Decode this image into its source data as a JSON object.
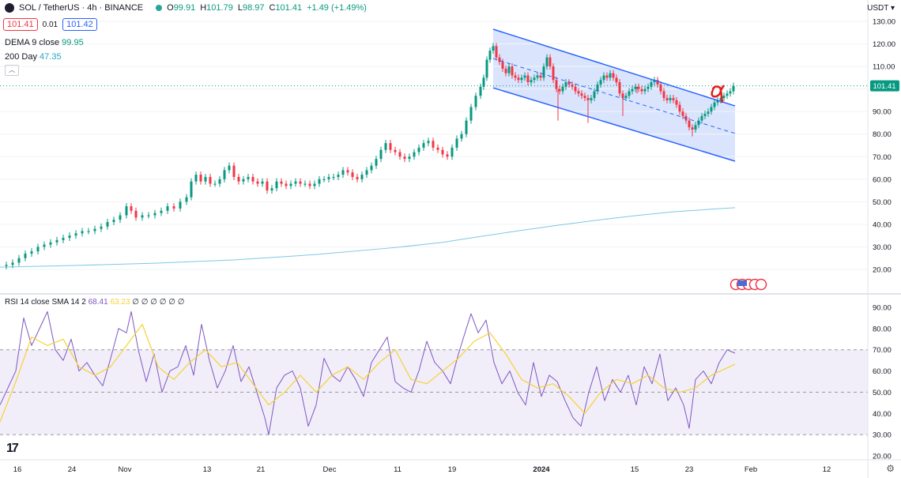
{
  "header": {
    "symbol": "SOL / TetherUS · 4h · BINANCE",
    "ohlc": [
      {
        "label": "O",
        "value": "99.91"
      },
      {
        "label": "H",
        "value": "101.79"
      },
      {
        "label": "L",
        "value": "98.97"
      },
      {
        "label": "C",
        "value": "101.41"
      }
    ],
    "change": "+1.49 (+1.49%)",
    "sell_price": "101.41",
    "spread": "0.01",
    "buy_price": "101.42",
    "currency": "USDT ▾"
  },
  "indicators": [
    {
      "name": "DEMA 9 close",
      "value": "99.95"
    },
    {
      "name": "200 Day",
      "value": "47.35"
    }
  ],
  "rsi_legend": {
    "name": "RSI 14 close SMA 14 2",
    "rsi": "68.41",
    "sma": "63.23",
    "rest": "∅ ∅ ∅ ∅ ∅ ∅"
  },
  "logo_text": "17",
  "chart_data": [
    {
      "type": "candlestick",
      "title": "SOL / TetherUS · 4h · BINANCE",
      "ylim": [
        15,
        132
      ],
      "yticks": [
        20,
        30,
        40,
        50,
        60,
        70,
        80,
        90,
        100,
        110,
        120,
        130
      ],
      "ytick_labels": [
        "20.00",
        "30.00",
        "40.00",
        "50.00",
        "60.00",
        "70.00",
        "80.00",
        "90.00",
        "",
        "110.00",
        "120.00",
        "130.00"
      ],
      "last_price": 101.41,
      "last_price_label": "101.41",
      "xticks": [
        "16",
        "24",
        "Nov",
        "13",
        "21",
        "Dec",
        "11",
        "19",
        "2024",
        "15",
        "23",
        "Feb",
        "12"
      ],
      "price_path": [
        [
          0,
          21.5
        ],
        [
          8,
          22
        ],
        [
          16,
          23
        ],
        [
          24,
          25
        ],
        [
          32,
          27
        ],
        [
          40,
          28
        ],
        [
          48,
          30
        ],
        [
          56,
          31
        ],
        [
          64,
          32
        ],
        [
          72,
          33
        ],
        [
          80,
          34
        ],
        [
          88,
          35
        ],
        [
          96,
          36
        ],
        [
          104,
          37
        ],
        [
          112,
          37
        ],
        [
          120,
          38
        ],
        [
          128,
          39
        ],
        [
          136,
          41
        ],
        [
          144,
          42
        ],
        [
          152,
          44
        ],
        [
          160,
          48
        ],
        [
          166,
          46
        ],
        [
          172,
          43
        ],
        [
          180,
          44
        ],
        [
          188,
          44
        ],
        [
          196,
          45
        ],
        [
          204,
          46
        ],
        [
          212,
          48
        ],
        [
          220,
          47
        ],
        [
          228,
          50
        ],
        [
          236,
          52
        ],
        [
          242,
          59
        ],
        [
          248,
          62
        ],
        [
          254,
          59
        ],
        [
          260,
          61
        ],
        [
          266,
          58
        ],
        [
          272,
          58
        ],
        [
          278,
          60
        ],
        [
          284,
          64
        ],
        [
          290,
          66
        ],
        [
          296,
          61
        ],
        [
          302,
          59
        ],
        [
          308,
          60
        ],
        [
          314,
          61
        ],
        [
          320,
          59
        ],
        [
          326,
          58
        ],
        [
          332,
          59
        ],
        [
          338,
          55
        ],
        [
          344,
          56
        ],
        [
          350,
          59
        ],
        [
          356,
          58
        ],
        [
          362,
          57
        ],
        [
          368,
          58
        ],
        [
          374,
          59
        ],
        [
          380,
          58
        ],
        [
          386,
          58
        ],
        [
          392,
          57
        ],
        [
          398,
          58
        ],
        [
          404,
          60
        ],
        [
          410,
          60
        ],
        [
          416,
          61
        ],
        [
          422,
          61
        ],
        [
          428,
          62
        ],
        [
          434,
          64
        ],
        [
          440,
          63
        ],
        [
          446,
          61
        ],
        [
          452,
          60
        ],
        [
          458,
          62
        ],
        [
          464,
          64
        ],
        [
          470,
          66
        ],
        [
          476,
          69
        ],
        [
          482,
          73
        ],
        [
          488,
          76
        ],
        [
          494,
          73
        ],
        [
          500,
          72
        ],
        [
          506,
          70
        ],
        [
          512,
          69
        ],
        [
          518,
          70
        ],
        [
          524,
          72
        ],
        [
          530,
          74
        ],
        [
          536,
          76
        ],
        [
          542,
          77
        ],
        [
          548,
          74
        ],
        [
          554,
          73
        ],
        [
          560,
          71
        ],
        [
          566,
          70
        ],
        [
          572,
          74
        ],
        [
          578,
          78
        ],
        [
          584,
          80
        ],
        [
          590,
          86
        ],
        [
          596,
          92
        ],
        [
          602,
          97
        ],
        [
          608,
          101
        ],
        [
          612,
          105
        ],
        [
          616,
          113
        ],
        [
          620,
          117
        ],
        [
          624,
          119
        ],
        [
          628,
          114
        ],
        [
          632,
          112
        ],
        [
          636,
          109
        ],
        [
          640,
          107
        ],
        [
          644,
          110
        ],
        [
          648,
          106
        ],
        [
          652,
          105
        ],
        [
          656,
          104
        ],
        [
          660,
          105
        ],
        [
          664,
          106
        ],
        [
          668,
          103
        ],
        [
          672,
          104
        ],
        [
          676,
          105
        ],
        [
          680,
          106
        ],
        [
          684,
          105
        ],
        [
          688,
          110
        ],
        [
          692,
          114
        ],
        [
          696,
          110
        ],
        [
          700,
          104
        ],
        [
          704,
          100
        ],
        [
          708,
          99
        ],
        [
          712,
          101
        ],
        [
          716,
          103
        ],
        [
          720,
          102
        ],
        [
          724,
          101
        ],
        [
          728,
          99
        ],
        [
          732,
          98
        ],
        [
          736,
          97
        ],
        [
          740,
          96
        ],
        [
          744,
          95
        ],
        [
          748,
          96
        ],
        [
          752,
          99
        ],
        [
          756,
          102
        ],
        [
          760,
          104
        ],
        [
          764,
          106
        ],
        [
          768,
          105
        ],
        [
          772,
          107
        ],
        [
          776,
          105
        ],
        [
          780,
          103
        ],
        [
          784,
          98
        ],
        [
          788,
          96
        ],
        [
          792,
          97
        ],
        [
          796,
          99
        ],
        [
          800,
          100
        ],
        [
          804,
          101
        ],
        [
          808,
          100
        ],
        [
          812,
          99
        ],
        [
          816,
          100
        ],
        [
          820,
          101
        ],
        [
          824,
          103
        ],
        [
          828,
          104
        ],
        [
          832,
          102
        ],
        [
          836,
          99
        ],
        [
          840,
          96
        ],
        [
          844,
          95
        ],
        [
          848,
          96
        ],
        [
          852,
          95
        ],
        [
          856,
          93
        ],
        [
          860,
          90
        ],
        [
          864,
          88
        ],
        [
          868,
          86
        ],
        [
          872,
          83
        ],
        [
          876,
          82
        ],
        [
          880,
          84
        ],
        [
          884,
          86
        ],
        [
          888,
          88
        ],
        [
          892,
          89
        ],
        [
          896,
          90
        ],
        [
          900,
          92
        ],
        [
          904,
          94
        ],
        [
          908,
          95
        ],
        [
          912,
          96
        ],
        [
          916,
          97
        ],
        [
          920,
          98
        ],
        [
          924,
          99
        ],
        [
          928,
          101.41
        ]
      ],
      "spikes": [
        [
          706,
          86
        ],
        [
          744,
          85
        ],
        [
          788,
          88
        ],
        [
          806,
          98
        ],
        [
          876,
          79
        ]
      ],
      "series": [
        {
          "name": "200 Day",
          "color": "#7ec8e3",
          "x": [
            0,
            100,
            200,
            300,
            400,
            500,
            560,
            600,
            650,
            700,
            750,
            800,
            850,
            900,
            930
          ],
          "values": [
            21,
            21.8,
            22.8,
            24.3,
            26.6,
            29.7,
            32,
            34.2,
            36.8,
            39.3,
            41.6,
            43.7,
            45.5,
            46.7,
            47.35
          ]
        },
        {
          "name": "Channel upper",
          "color": "#2962ff",
          "x": [
            624,
            930
          ],
          "values": [
            126.5,
            92.5
          ]
        },
        {
          "name": "Channel lower",
          "color": "#2962ff",
          "x": [
            624,
            930
          ],
          "values": [
            100.5,
            68
          ]
        },
        {
          "name": "Channel mid",
          "color": "#2962ff",
          "x": [
            624,
            930
          ],
          "values": [
            113.5,
            80.3
          ]
        }
      ]
    },
    {
      "type": "line",
      "title": "RSI 14 close SMA 14 2",
      "ylim": [
        19,
        95
      ],
      "yticks": [
        20,
        30,
        40,
        50,
        60,
        70,
        80,
        90
      ],
      "ytick_labels": [
        "20.00",
        "30.00",
        "40.00",
        "50.00",
        "60.00",
        "70.00",
        "80.00",
        "90.00"
      ],
      "band": [
        30,
        70
      ],
      "series": [
        {
          "name": "RSI",
          "color": "#7e57c2",
          "x": [
            0,
            10,
            20,
            30,
            40,
            50,
            60,
            70,
            80,
            90,
            100,
            110,
            120,
            130,
            140,
            150,
            160,
            166,
            175,
            185,
            195,
            205,
            215,
            225,
            235,
            245,
            255,
            265,
            275,
            285,
            295,
            305,
            315,
            325,
            335,
            340,
            350,
            360,
            370,
            380,
            390,
            400,
            410,
            420,
            430,
            440,
            450,
            460,
            470,
            480,
            490,
            500,
            510,
            520,
            530,
            540,
            550,
            560,
            570,
            580,
            590,
            596,
            605,
            615,
            625,
            635,
            645,
            655,
            665,
            675,
            685,
            695,
            705,
            715,
            725,
            735,
            745,
            755,
            765,
            775,
            785,
            795,
            805,
            815,
            825,
            835,
            845,
            855,
            865,
            872,
            880,
            890,
            900,
            910,
            920,
            930
          ],
          "values": [
            44,
            52,
            60,
            85,
            72,
            80,
            88,
            70,
            65,
            75,
            60,
            64,
            58,
            53,
            66,
            80,
            78,
            88,
            70,
            55,
            68,
            50,
            60,
            62,
            72,
            58,
            82,
            65,
            52,
            60,
            72,
            55,
            62,
            50,
            38,
            30,
            52,
            58,
            60,
            52,
            34,
            44,
            66,
            58,
            55,
            62,
            56,
            48,
            64,
            70,
            76,
            55,
            52,
            50,
            60,
            74,
            64,
            60,
            54,
            68,
            80,
            87,
            78,
            84,
            64,
            54,
            60,
            50,
            44,
            64,
            48,
            58,
            55,
            46,
            38,
            34,
            50,
            62,
            46,
            56,
            50,
            58,
            44,
            62,
            54,
            68,
            46,
            52,
            44,
            33,
            56,
            60,
            54,
            64,
            70,
            68.41
          ]
        },
        {
          "name": "SMA",
          "color": "#f5d234",
          "x": [
            0,
            20,
            40,
            60,
            80,
            100,
            120,
            140,
            160,
            180,
            200,
            220,
            240,
            260,
            280,
            300,
            320,
            340,
            360,
            380,
            400,
            420,
            440,
            460,
            480,
            500,
            520,
            540,
            560,
            580,
            600,
            620,
            640,
            660,
            680,
            700,
            720,
            740,
            760,
            780,
            800,
            820,
            840,
            860,
            880,
            900,
            930
          ],
          "values": [
            36,
            55,
            76,
            72,
            75,
            62,
            58,
            62,
            72,
            82,
            62,
            56,
            64,
            70,
            62,
            64,
            54,
            44,
            50,
            58,
            50,
            58,
            62,
            56,
            64,
            70,
            56,
            54,
            60,
            66,
            74,
            78,
            68,
            56,
            52,
            54,
            48,
            40,
            50,
            56,
            54,
            58,
            52,
            50,
            52,
            58,
            63.23
          ]
        }
      ]
    }
  ]
}
